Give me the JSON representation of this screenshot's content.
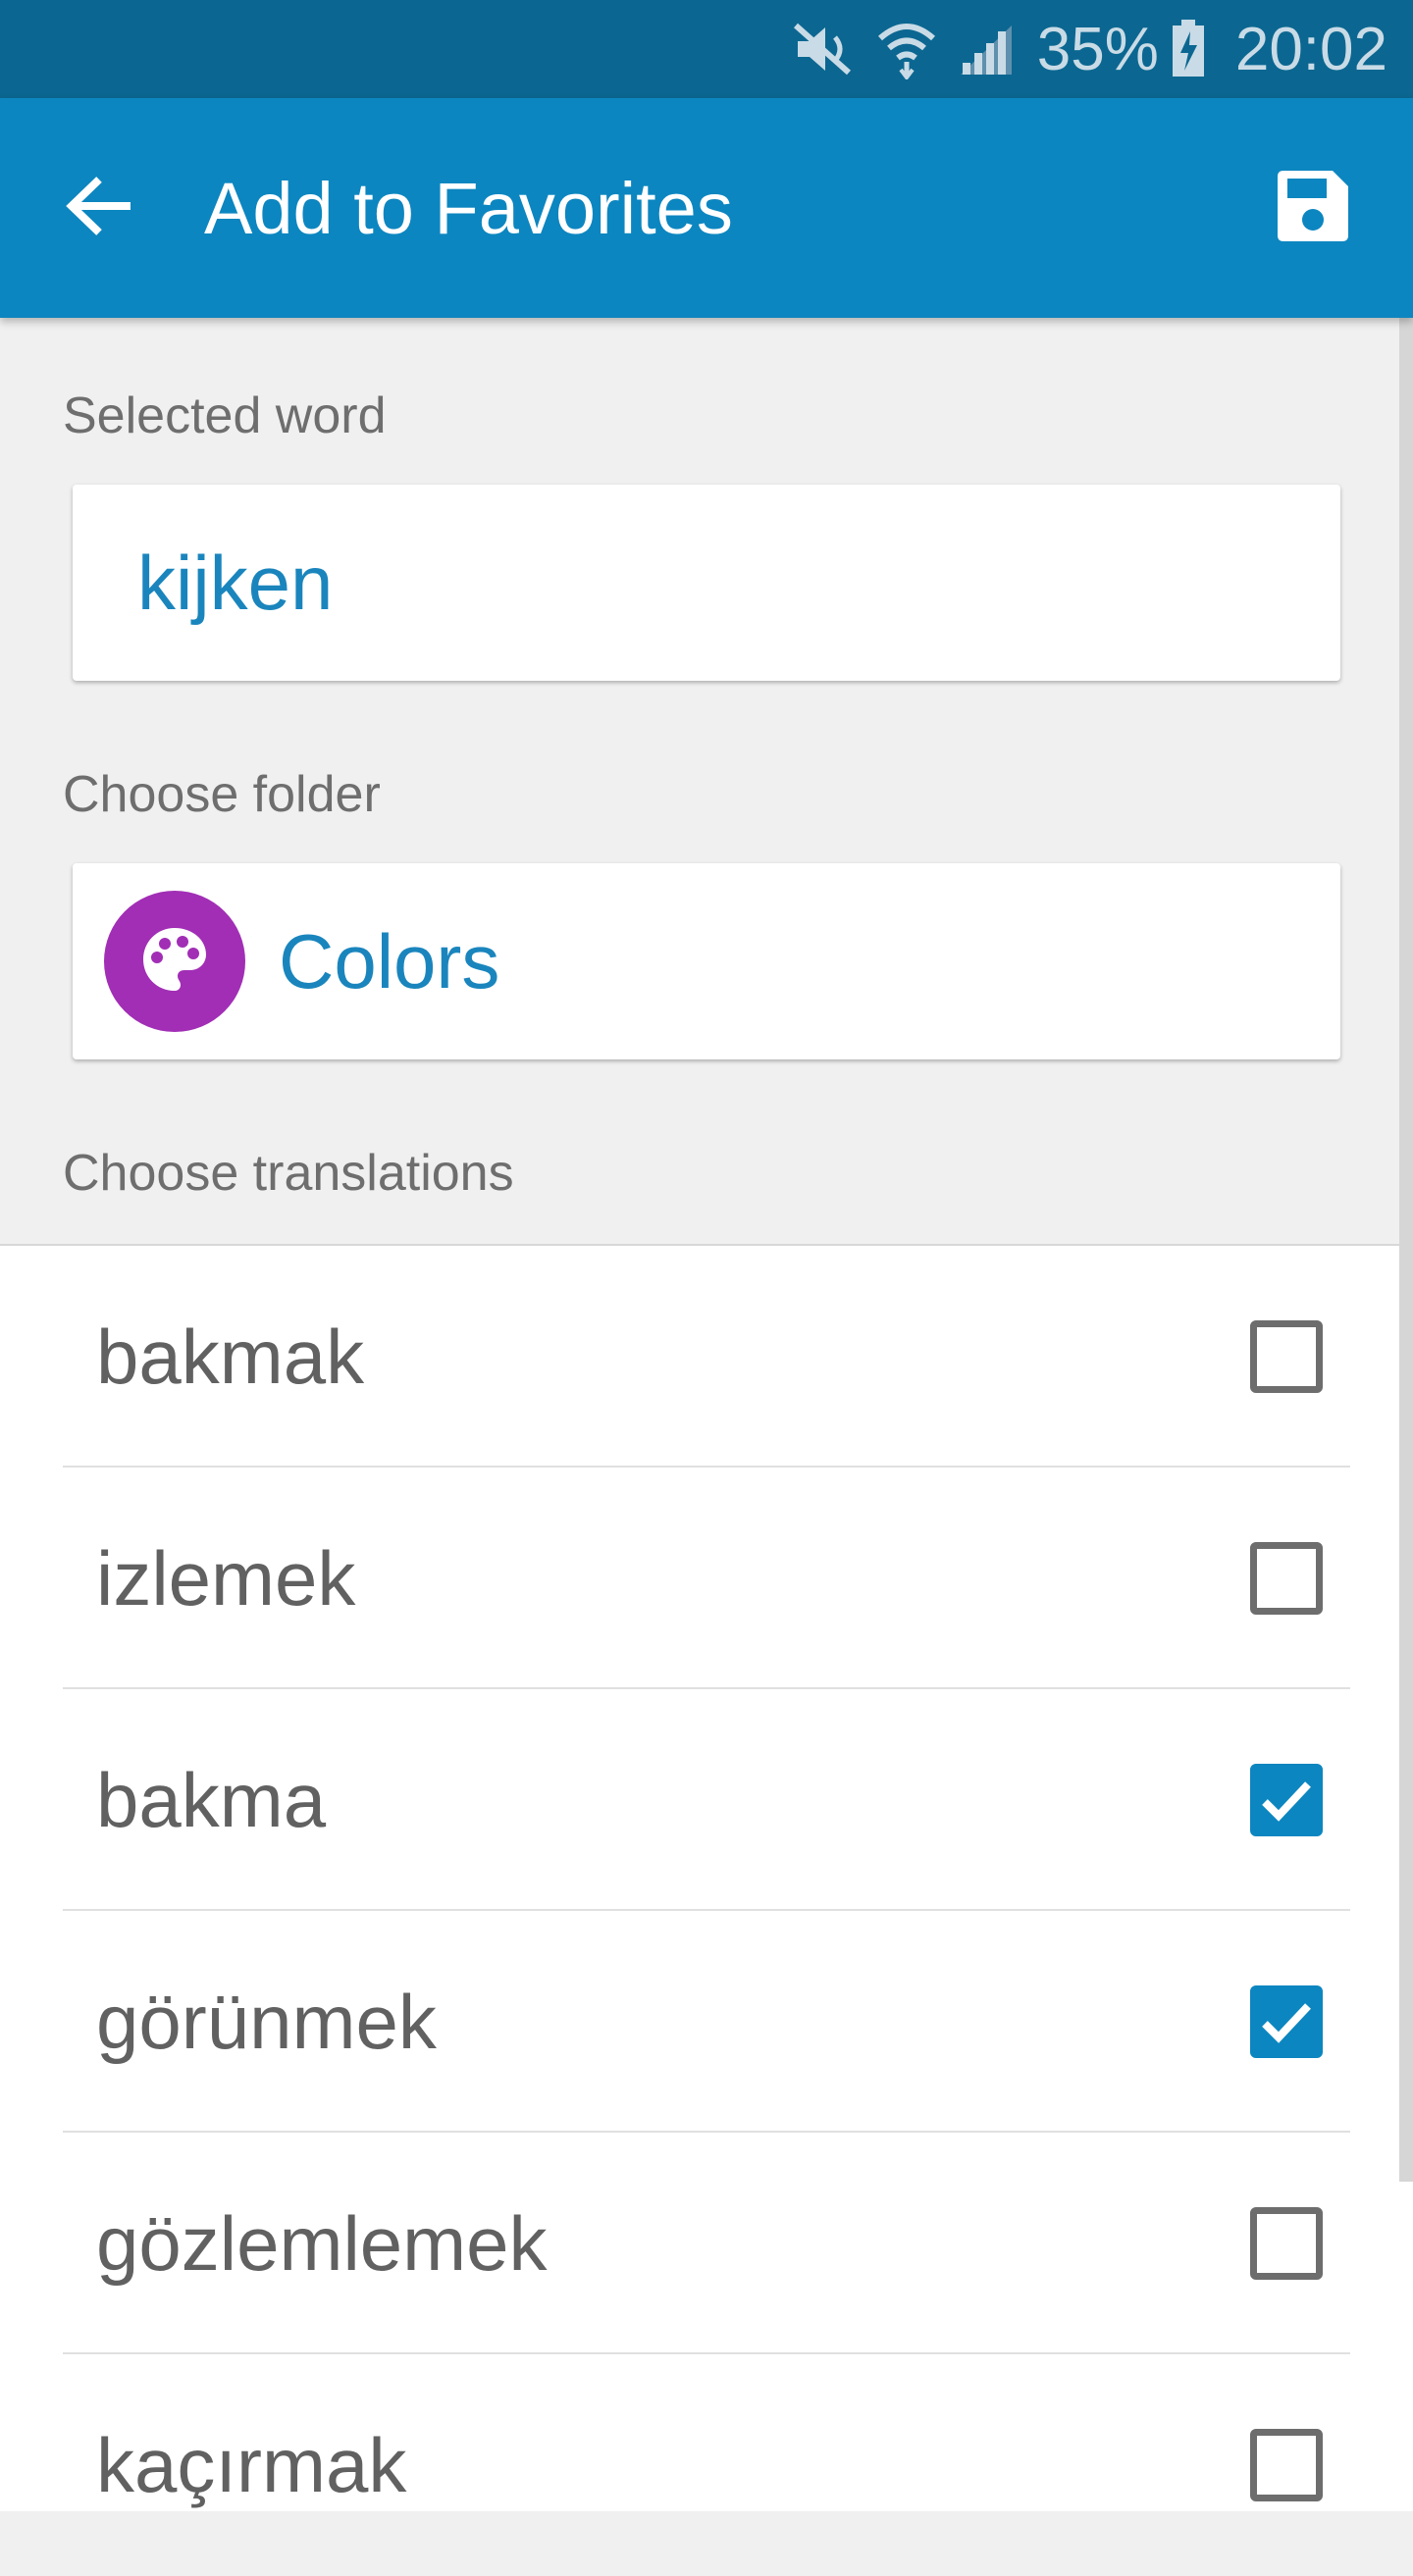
{
  "status_bar": {
    "battery_percent": "35%",
    "time": "20:02",
    "icons": [
      "mute-icon",
      "wifi-icon",
      "signal-icon",
      "battery-charging-icon"
    ]
  },
  "app_bar": {
    "title": "Add to Favorites",
    "back_icon": "arrow-back-icon",
    "save_icon": "save-icon"
  },
  "selected_word": {
    "label": "Selected word",
    "value": "kijken"
  },
  "folder": {
    "label": "Choose folder",
    "name": "Colors",
    "icon": "palette-icon",
    "icon_color": "#a12eb5"
  },
  "translations": {
    "label": "Choose translations",
    "items": [
      {
        "text": "bakmak",
        "checked": false
      },
      {
        "text": "izlemek",
        "checked": false
      },
      {
        "text": "bakma",
        "checked": true
      },
      {
        "text": "görünmek",
        "checked": true
      },
      {
        "text": "gözlemlemek",
        "checked": false
      },
      {
        "text": "kaçırmak",
        "checked": false
      }
    ]
  },
  "colors": {
    "status_bar": "#0b6791",
    "app_bar": "#0c86c0",
    "accent_text": "#1a85bd",
    "checkbox_checked": "#0c86c0"
  }
}
